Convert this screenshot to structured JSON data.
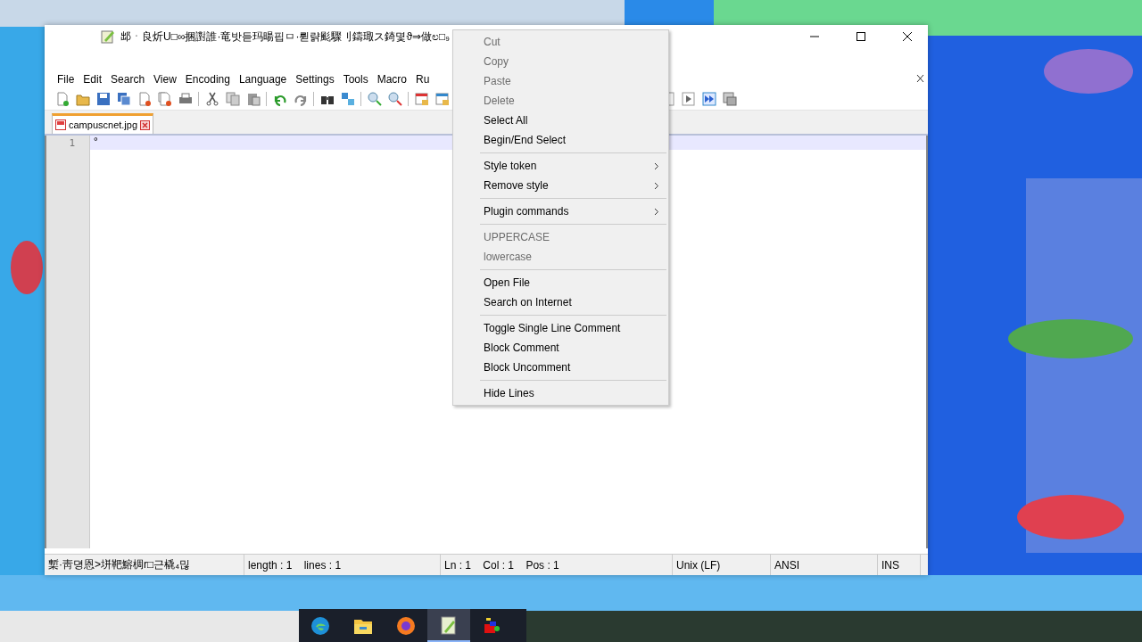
{
  "window": {
    "title": "䢺ㆍ良炘U□∞捆譵誰·竜밧듣玛暘핍ㅁ·륃랽颩驟刂鑄㻓ス錡몇ϑ⇒做ಲ□₉"
  },
  "menu_bar": [
    "File",
    "Edit",
    "Search",
    "View",
    "Encoding",
    "Language",
    "Settings",
    "Tools",
    "Macro",
    "Ru"
  ],
  "tabs": [
    {
      "label": "campuscnet.jpg",
      "selected": true
    }
  ],
  "editor": {
    "lines": [
      {
        "number": "1",
        "text": "°",
        "current": true
      }
    ]
  },
  "context_menu": [
    {
      "kind": "item",
      "label": "Cut",
      "disabled": true,
      "submenu": false
    },
    {
      "kind": "item",
      "label": "Copy",
      "disabled": true,
      "submenu": false
    },
    {
      "kind": "item",
      "label": "Paste",
      "disabled": true,
      "submenu": false
    },
    {
      "kind": "item",
      "label": "Delete",
      "disabled": true,
      "submenu": false
    },
    {
      "kind": "item",
      "label": "Select All",
      "disabled": false,
      "submenu": false
    },
    {
      "kind": "item",
      "label": "Begin/End Select",
      "disabled": false,
      "submenu": false
    },
    {
      "kind": "separator"
    },
    {
      "kind": "item",
      "label": "Style token",
      "disabled": false,
      "submenu": true
    },
    {
      "kind": "item",
      "label": "Remove style",
      "disabled": false,
      "submenu": true
    },
    {
      "kind": "separator"
    },
    {
      "kind": "item",
      "label": "Plugin commands",
      "disabled": false,
      "submenu": true
    },
    {
      "kind": "separator"
    },
    {
      "kind": "item",
      "label": "UPPERCASE",
      "disabled": true,
      "submenu": false
    },
    {
      "kind": "item",
      "label": "lowercase",
      "disabled": true,
      "submenu": false
    },
    {
      "kind": "separator"
    },
    {
      "kind": "item",
      "label": "Open File",
      "disabled": false,
      "submenu": false
    },
    {
      "kind": "item",
      "label": "Search on Internet",
      "disabled": false,
      "submenu": false
    },
    {
      "kind": "separator"
    },
    {
      "kind": "item",
      "label": "Toggle Single Line Comment",
      "disabled": false,
      "submenu": false
    },
    {
      "kind": "item",
      "label": "Block Comment",
      "disabled": false,
      "submenu": false
    },
    {
      "kind": "item",
      "label": "Block Uncomment",
      "disabled": false,
      "submenu": false
    },
    {
      "kind": "separator"
    },
    {
      "kind": "item",
      "label": "Hide Lines",
      "disabled": false,
      "submenu": false
    }
  ],
  "status_bar": [
    "槧·靑뎡恩>垪靶鰫椆r□근橇₄믾",
    "length : 1    lines : 1",
    "Ln : 1    Col : 1    Pos : 1",
    "Unix (LF)",
    "ANSI",
    "INS"
  ],
  "taskbar": [
    {
      "kind": "edge",
      "selected": false
    },
    {
      "kind": "folder",
      "selected": false
    },
    {
      "kind": "firefox",
      "selected": false
    },
    {
      "kind": "notepad",
      "selected": true
    },
    {
      "kind": "app",
      "selected": false
    }
  ]
}
